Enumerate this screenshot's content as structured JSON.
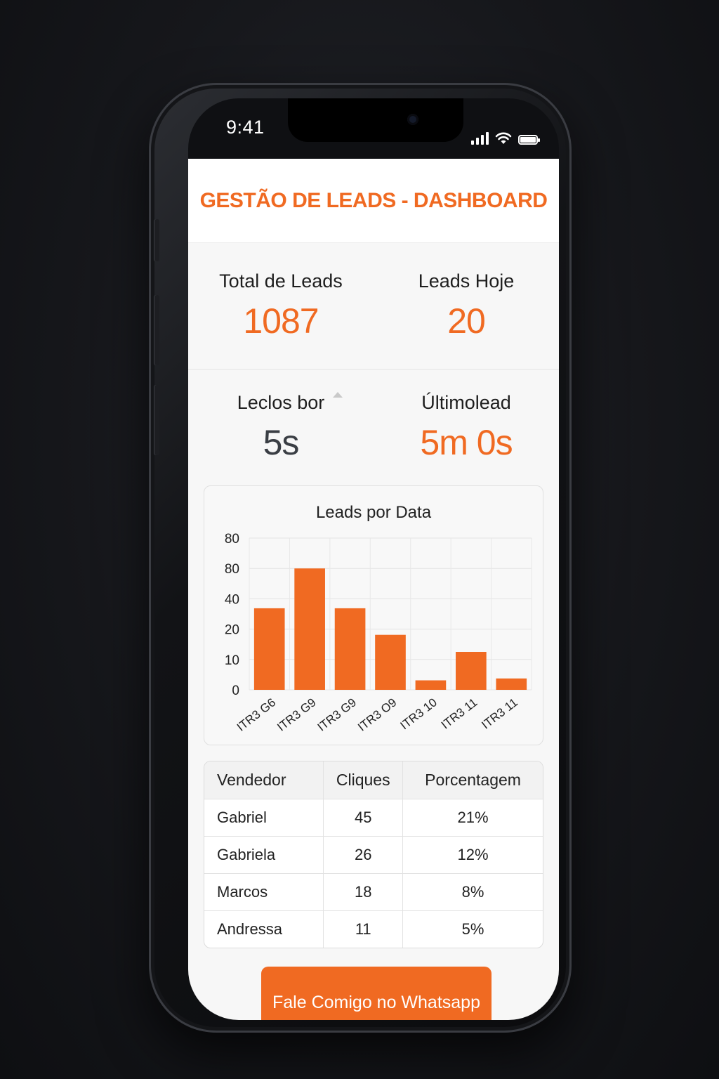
{
  "status_bar": {
    "time": "9:41"
  },
  "header": {
    "title": "GESTÃO DE LEADS - DASHBOARD"
  },
  "stats": {
    "total_leads": {
      "label": "Total de Leads",
      "value": "1087"
    },
    "leads_today": {
      "label": "Leads Hoje",
      "value": "20"
    },
    "response": {
      "label": "Leclos bor",
      "value": "5s"
    },
    "last_lead": {
      "label": "Últimolead",
      "value": "5m 0s"
    }
  },
  "colors": {
    "accent": "#f06a22",
    "background": "#f7f7f7"
  },
  "chart_data": {
    "type": "bar",
    "title": "Leads por Data",
    "categories": [
      "ITR3 G6",
      "ITR3 G9",
      "ITR3 G9",
      "ITR3 O9",
      "ITR3 10",
      "ITR3 11",
      "ITR3 11"
    ],
    "values": [
      43,
      64,
      43,
      29,
      5,
      20,
      6
    ],
    "y_ticks": [
      "0",
      "10",
      "20",
      "40",
      "80",
      "80"
    ],
    "ylim": [
      0,
      80
    ],
    "grid": true
  },
  "table": {
    "headers": [
      "Vendedor",
      "Cliques",
      "Porcentagem"
    ],
    "rows": [
      [
        "Gabriel",
        "45",
        "21%"
      ],
      [
        "Gabriela",
        "26",
        "12%"
      ],
      [
        "Marcos",
        "18",
        "8%"
      ],
      [
        "Andressa",
        "11",
        "5%"
      ]
    ]
  },
  "cta": {
    "label": "Fale Comigo no Whatsapp"
  }
}
